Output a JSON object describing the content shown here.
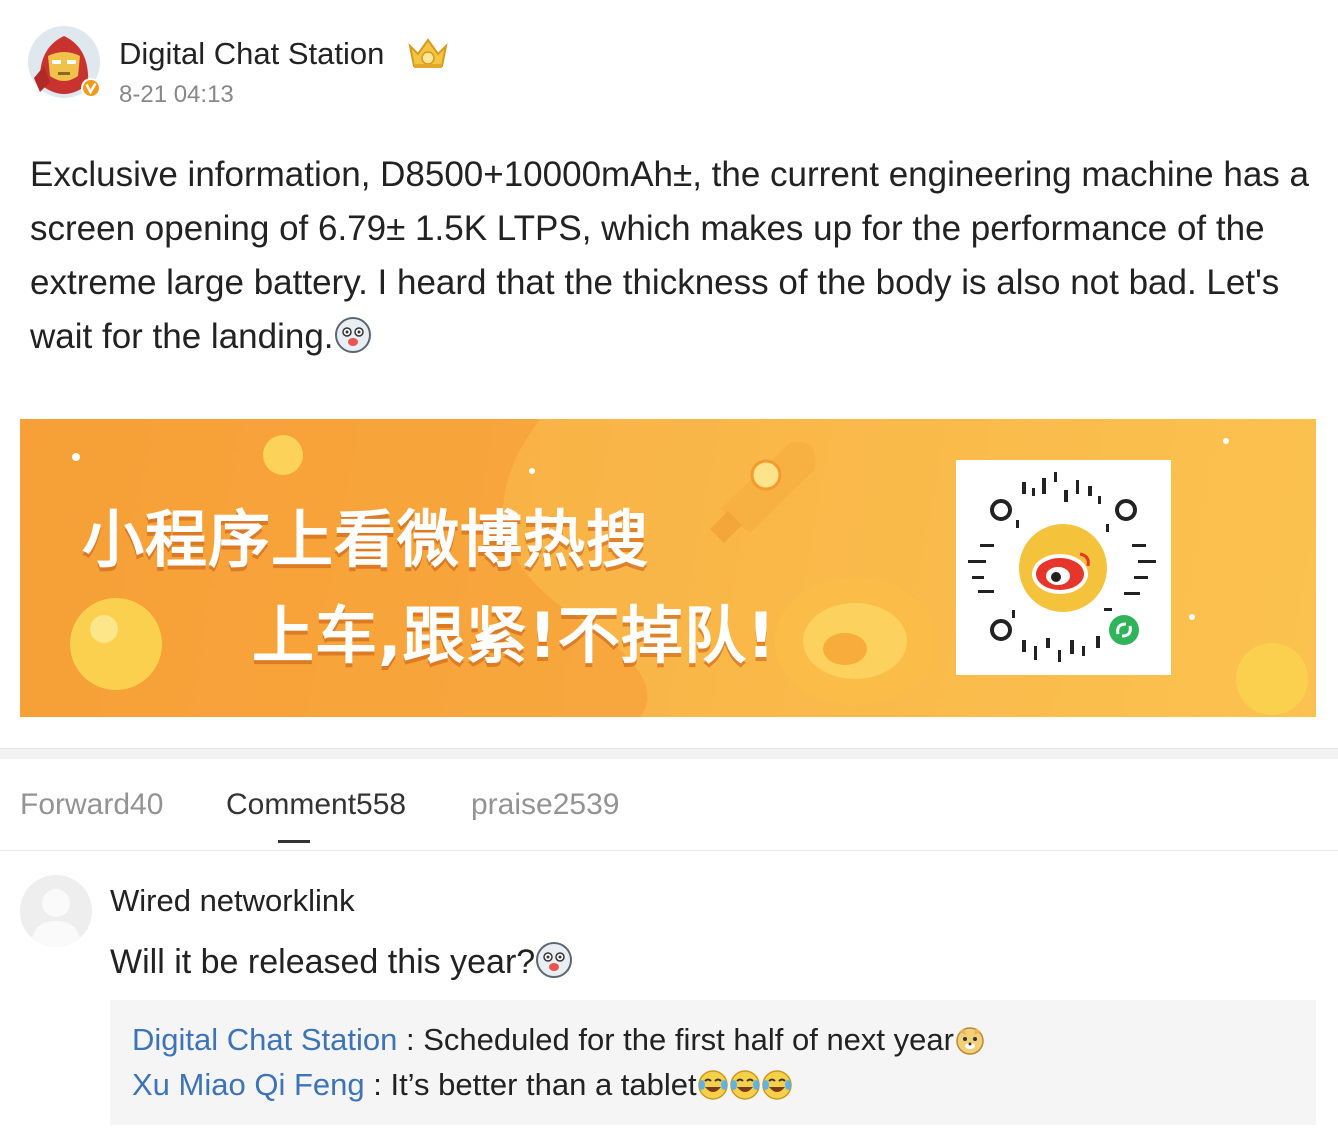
{
  "post": {
    "author": "Digital Chat Station",
    "time": "8-21 04:13",
    "text": "Exclusive information, D8500+10000mAh±, the current engineering machine has a screen opening of 6.79± 1.5K LTPS, which makes up for the performance of the extreme large battery. I heard that the thickness of the body is also not bad. Let's wait for the landing.",
    "badges": [
      "verified-v-icon",
      "crown-level-icon"
    ],
    "text_emoji": "husky-emoji-icon"
  },
  "banner": {
    "line1": "小程序上看微博热搜",
    "line2": "上车,跟紧!不掉队!",
    "qr_icon": "weibo-mini-program-qr-icon",
    "colors": {
      "bg_start": "#f7a63b",
      "bg_end": "#fbc24f",
      "text": "#ffffff"
    }
  },
  "tabs": {
    "forward": "Forward40",
    "comment": "Comment558",
    "praise": "praise2539",
    "active": "comment"
  },
  "comment": {
    "user": "Wired networklink",
    "text": "Will it be released this year?",
    "emoji": "husky-emoji-icon",
    "replies": [
      {
        "name": "Digital Chat Station",
        "sep": " : ",
        "text": "Scheduled for the first half of next year",
        "emoji": "doge-emoji-icon"
      },
      {
        "name": "Xu Miao Qi Feng",
        "sep": " : ",
        "text": "It’s better than a tablet",
        "emoji": "laugh-cry-emoji-icon"
      }
    ]
  },
  "colors": {
    "link": "#3d74b8",
    "muted": "#888888",
    "tab_inactive": "#939393"
  }
}
